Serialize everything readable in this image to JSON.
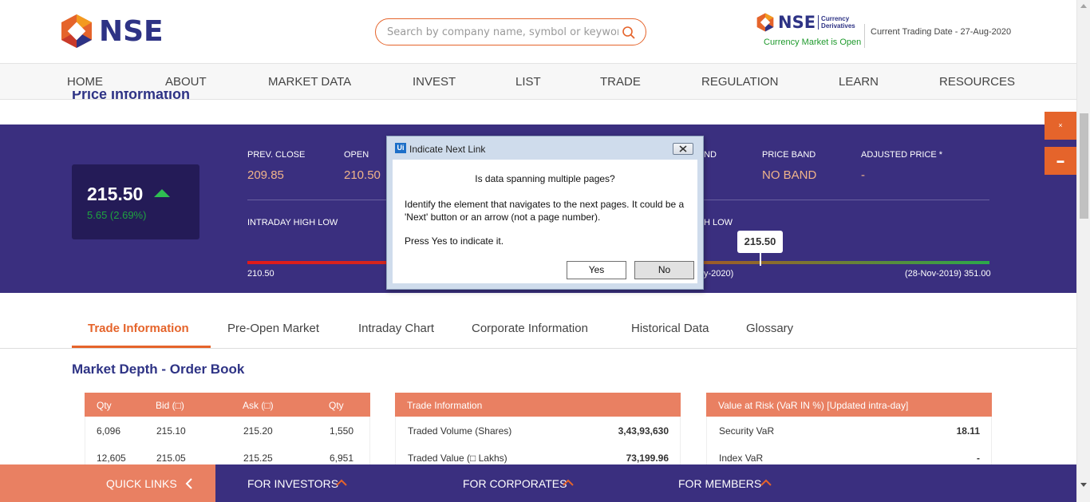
{
  "header": {
    "logo_text": "NSE",
    "search_placeholder": "Search by company name, symbol or keyword",
    "currency": {
      "logo": "NSE",
      "sub1": "Currency",
      "sub2": "Derivatives",
      "status": "Currency Market is Open"
    },
    "trade_date": "Current Trading Date - 27-Aug-2020"
  },
  "nav": [
    "HOME",
    "ABOUT",
    "MARKET DATA",
    "INVEST",
    "LIST",
    "TRADE",
    "REGULATION",
    "LEARN",
    "RESOURCES"
  ],
  "price": {
    "section_title": "Price Information",
    "ltp": "215.50",
    "change": "5.65 (2.69%)",
    "prev_close_label": "PREV. CLOSE",
    "prev_close": "209.85",
    "open_label": "OPEN",
    "open": "210.50",
    "nd_label": "ND",
    "price_band_label": "PRICE BAND",
    "price_band": "NO BAND",
    "adj_price_label": "ADJUSTED PRICE *",
    "adj_price": "-",
    "intraday_label": "INTRADAY HIGH LOW",
    "h_low_label": "H LOW",
    "intraday_low": "210.50",
    "tooltip": "215.50",
    "range_mid": "y-2020)",
    "range_high": "(28-Nov-2019) 351.00"
  },
  "side_buttons": [
    "×",
    "▬"
  ],
  "tabs": [
    "Trade Information",
    "Pre-Open Market",
    "Intraday Chart",
    "Corporate Information",
    "Historical Data",
    "Glossary"
  ],
  "market_depth": {
    "title": "Market Depth - Order Book",
    "headers": [
      "Qty",
      "Bid (□)",
      "Ask (□)",
      "Qty"
    ],
    "rows": [
      [
        "6,096",
        "215.10",
        "215.20",
        "1,550"
      ],
      [
        "12,605",
        "215.05",
        "215.25",
        "6,951"
      ]
    ]
  },
  "trade_info": {
    "title": "Trade Information",
    "rows": [
      [
        "Traded Volume (Shares)",
        "3,43,93,630"
      ],
      [
        "Traded Value (□ Lakhs)",
        "73,199.96"
      ]
    ]
  },
  "var": {
    "title": "Value at Risk (VaR IN %) [Updated intra-day]",
    "rows": [
      [
        "Security VaR",
        "18.11"
      ],
      [
        "Index VaR",
        "-"
      ]
    ]
  },
  "footer": {
    "quick_links": "QUICK LINKS",
    "investors": "FOR INVESTORS",
    "corporates": "FOR CORPORATES",
    "members": "FOR MEMBERS"
  },
  "dialog": {
    "icon": "Ui",
    "title": "Indicate Next Link",
    "question": "Is data spanning multiple pages?",
    "line1": "Identify the element that navigates to the next pages. It could be a",
    "line2": "'Next' button or an arrow (not a page number).",
    "line3": "Press Yes to indicate it.",
    "yes": "Yes",
    "no": "No"
  },
  "colors": {
    "brand_blue": "#2e3385",
    "accent_orange": "#e5642b",
    "band_purple": "#3a2f7f",
    "status_green": "#1f9a2d"
  }
}
